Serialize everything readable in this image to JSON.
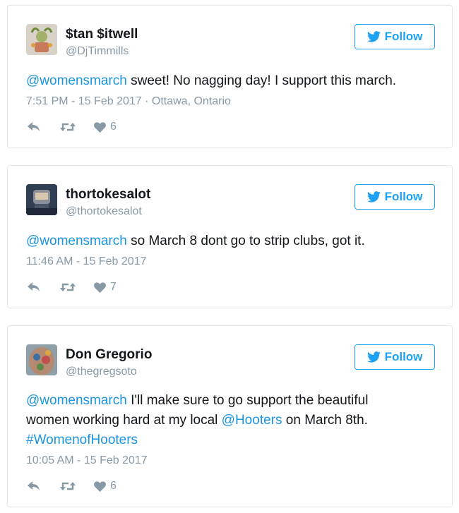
{
  "tweets": [
    {
      "name": "$tan $itwell",
      "handle": "@DjTimmills",
      "follow_label": "Follow",
      "text_parts": [
        "@womensmarch",
        " sweet! No nagging day! I support this march."
      ],
      "meta": "7:51 PM - 15 Feb 2017",
      "location": "Ottawa, Ontario",
      "likes": "6"
    },
    {
      "name": "thortokesalot",
      "handle": "@thortokesalot",
      "follow_label": "Follow",
      "text_parts": [
        "@womensmarch",
        " so March 8 dont go to strip clubs, got it."
      ],
      "meta": "11:46 AM - 15 Feb 2017",
      "likes": "7"
    },
    {
      "name": "Don Gregorio",
      "handle": "@thegregsoto",
      "follow_label": "Follow",
      "text_parts": [
        "@womensmarch",
        " I'll make sure to go support the beautiful",
        "women working hard at my local ",
        "@Hooters",
        " on March 8th.",
        "#WomenofHooters"
      ],
      "meta": "10:05 AM - 15 Feb 2017",
      "likes": "6"
    }
  ],
  "colors": {
    "accent": "#1da1f2",
    "link": "#1b95e0",
    "muted": "#8899a6",
    "border": "#e1e8ed"
  }
}
